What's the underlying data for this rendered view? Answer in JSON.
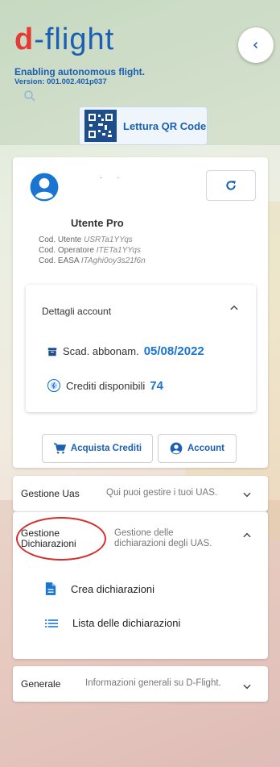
{
  "header": {
    "logo_prefix": "d",
    "logo_rest": "-flight",
    "tagline": "Enabling autonomous flight.",
    "version": "Version: 001.002.401p037",
    "qr_button_label": "Lettura QR Code"
  },
  "user_card": {
    "role_title": "Utente Pro",
    "codes": [
      {
        "label": "Cod. Utente",
        "value": "USRTa1YYqs"
      },
      {
        "label": "Cod. Operatore",
        "value": "ITETa1YYqs"
      },
      {
        "label": "Cod. EASA",
        "value": "ITAghi0oy3s21f6n"
      }
    ],
    "account_details": {
      "title": "Dettagli account",
      "scad_label": "Scad. abbonam.",
      "scad_value": "05/08/2022",
      "credits_label": "Crediti disponibili",
      "credits_value": "74"
    },
    "buy_credits_label": "Acquista Crediti",
    "account_label": "Account"
  },
  "panels": {
    "uas": {
      "title": "Gestione Uas",
      "description": "Qui puoi gestire i tuoi UAS."
    },
    "dichiarazioni": {
      "title_line1": "Gestione",
      "title_line2": "Dichiarazioni",
      "description_line1": "Gestione delle",
      "description_line2": "dichiarazioni degli UAS.",
      "items": [
        {
          "label": "Crea dichiarazioni",
          "icon": "document-icon"
        },
        {
          "label": "Lista delle dichiarazioni",
          "icon": "list-icon"
        }
      ]
    },
    "generale": {
      "title": "Generale",
      "description": "Informazioni generali su D-Flight."
    }
  },
  "colors": {
    "brand_blue": "#1a5fb4",
    "accent_red": "#e53935",
    "value_blue": "#1a75d2",
    "highlight_circle": "#d32f2f"
  }
}
